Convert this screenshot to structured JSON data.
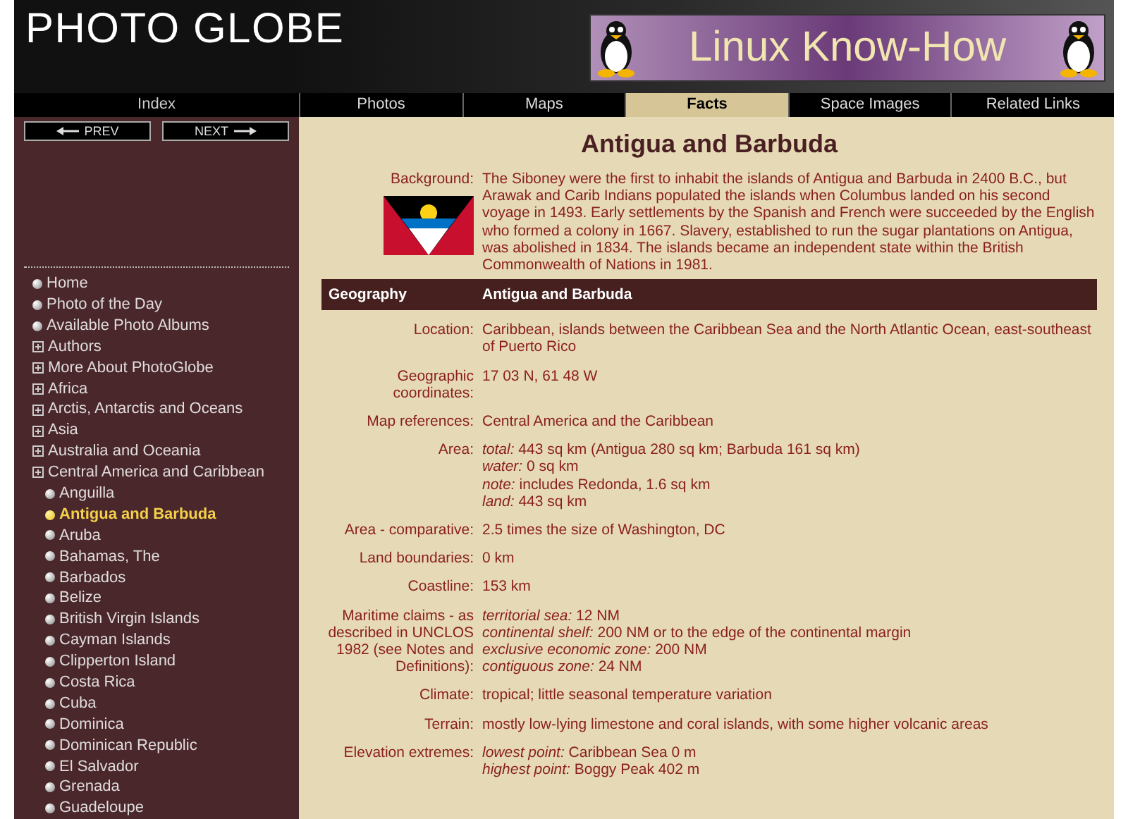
{
  "header": {
    "logo": "PHOTO GLOBE",
    "banner": "Linux Know-How"
  },
  "sidebar": {
    "title": "Index",
    "prev": "PREV",
    "next": "NEXT",
    "items": [
      {
        "label": "Home",
        "kind": "bullet",
        "selected": false
      },
      {
        "label": "Photo of the Day",
        "kind": "bullet",
        "selected": false
      },
      {
        "label": "Available Photo Albums",
        "kind": "bullet",
        "selected": false
      },
      {
        "label": "Authors",
        "kind": "folder",
        "selected": false
      },
      {
        "label": "More About PhotoGlobe",
        "kind": "folder",
        "selected": false
      },
      {
        "label": "Africa",
        "kind": "folder",
        "selected": false
      },
      {
        "label": "Arctis, Antarctis and Oceans",
        "kind": "folder",
        "selected": false
      },
      {
        "label": "Asia",
        "kind": "folder",
        "selected": false
      },
      {
        "label": "Australia and Oceania",
        "kind": "folder",
        "selected": false
      },
      {
        "label": "Central America and Caribbean",
        "kind": "folder",
        "selected": false,
        "children": [
          {
            "label": "Anguilla",
            "kind": "bullet",
            "selected": false
          },
          {
            "label": "Antigua and Barbuda",
            "kind": "bullet",
            "selected": true
          },
          {
            "label": "Aruba",
            "kind": "bullet",
            "selected": false
          },
          {
            "label": "Bahamas, The",
            "kind": "bullet",
            "selected": false
          },
          {
            "label": "Barbados",
            "kind": "bullet",
            "selected": false
          },
          {
            "label": "Belize",
            "kind": "bullet",
            "selected": false
          },
          {
            "label": "British Virgin Islands",
            "kind": "bullet",
            "selected": false
          },
          {
            "label": "Cayman Islands",
            "kind": "bullet",
            "selected": false
          },
          {
            "label": "Clipperton Island",
            "kind": "bullet",
            "selected": false
          },
          {
            "label": "Costa Rica",
            "kind": "bullet",
            "selected": false
          },
          {
            "label": "Cuba",
            "kind": "bullet",
            "selected": false
          },
          {
            "label": "Dominica",
            "kind": "bullet",
            "selected": false
          },
          {
            "label": "Dominican Republic",
            "kind": "bullet",
            "selected": false
          },
          {
            "label": "El Salvador",
            "kind": "bullet",
            "selected": false
          },
          {
            "label": "Grenada",
            "kind": "bullet",
            "selected": false
          },
          {
            "label": "Guadeloupe",
            "kind": "bullet",
            "selected": false
          }
        ]
      }
    ]
  },
  "tabs": [
    {
      "label": "Photos",
      "selected": false
    },
    {
      "label": "Maps",
      "selected": false
    },
    {
      "label": "Facts",
      "selected": true
    },
    {
      "label": "Space Images",
      "selected": false
    },
    {
      "label": "Related Links",
      "selected": false
    }
  ],
  "content": {
    "title": "Antigua and Barbuda",
    "background": {
      "label": "Background:",
      "text": "The Siboney were the first to inhabit the islands of Antigua and Barbuda in 2400 B.C., but Arawak and Carib Indians populated the islands when Columbus landed on his second voyage in 1493. Early settlements by the Spanish and French were succeeded by the English who formed a colony in 1667. Slavery, established to run the sugar plantations on Antigua, was abolished in 1834. The islands became an independent state within the British Commonwealth of Nations in 1981."
    },
    "section": {
      "label": "Geography",
      "value": "Antigua and Barbuda"
    },
    "rows": [
      {
        "label": "Location:",
        "lines": [
          "Caribbean, islands between the Caribbean Sea and the North Atlantic Ocean, east-southeast of Puerto Rico"
        ]
      },
      {
        "label": "Geographic coordinates:",
        "lines": [
          "17 03 N, 61 48 W"
        ]
      },
      {
        "label": "Map references:",
        "lines": [
          "Central America and the Caribbean"
        ]
      },
      {
        "label": "Area:",
        "lines": [
          "*total:* 443 sq km (Antigua 280 sq km; Barbuda 161 sq km)",
          "*water:* 0 sq km",
          "*note:* includes Redonda, 1.6 sq km",
          "*land:* 443 sq km"
        ]
      },
      {
        "label": "Area - comparative:",
        "lines": [
          "2.5 times the size of Washington, DC"
        ]
      },
      {
        "label": "Land boundaries:",
        "lines": [
          "0 km"
        ]
      },
      {
        "label": "Coastline:",
        "lines": [
          "153 km"
        ]
      },
      {
        "label": "Maritime claims - as described in UNCLOS 1982 (see Notes and Definitions):",
        "lines": [
          "*territorial sea:* 12 NM",
          "*continental shelf:* 200 NM or to the edge of the continental margin",
          "*exclusive economic zone:* 200 NM",
          "*contiguous zone:* 24 NM"
        ]
      },
      {
        "label": "Climate:",
        "lines": [
          "tropical; little seasonal temperature variation"
        ]
      },
      {
        "label": "Terrain:",
        "lines": [
          "mostly low-lying limestone and coral islands, with some higher volcanic areas"
        ]
      },
      {
        "label": "Elevation extremes:",
        "lines": [
          "*lowest point:* Caribbean Sea 0 m",
          "*highest point:* Boggy Peak 402 m"
        ]
      }
    ]
  }
}
